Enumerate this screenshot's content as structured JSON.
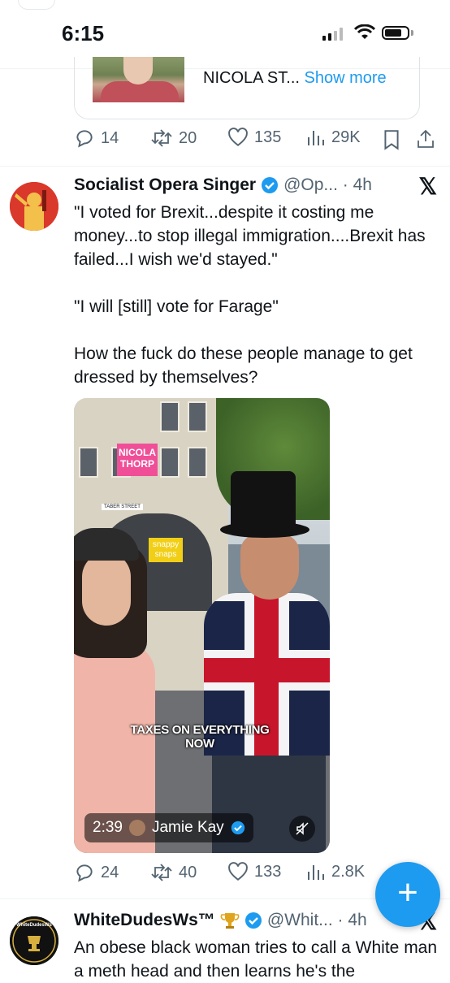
{
  "status_bar": {
    "time": "6:15"
  },
  "quoted_preview": {
    "text": "NICOLA ST...",
    "show_more": "Show more"
  },
  "tweet_prev_actions": {
    "replies": "14",
    "reposts": "20",
    "likes": "135",
    "views": "29K"
  },
  "tweet1": {
    "name": "Socialist Opera Singer",
    "handle": "@Op... · 4h",
    "text": "\"I voted for Brexit...despite it costing me money...to stop illegal immigration....Brexit has failed...I wish we'd stayed.\"\n\n\"I will [still] vote for Farage\"\n\nHow the fuck do these people manage to get dressed by themselves?",
    "media": {
      "logo_text": "NICOLA THORP",
      "street_sign": "TABER STREET",
      "shop_sign": "snappy snaps",
      "caption": "TAXES ON EVERYTHING NOW",
      "duration": "2:39",
      "author": "Jamie Kay"
    },
    "actions": {
      "replies": "24",
      "reposts": "40",
      "likes": "133",
      "views": "2.8K"
    }
  },
  "tweet2": {
    "name": "WhiteDudesWs™",
    "handle": "@Whit... · 4h",
    "text": "An obese black woman tries to call a White man a meth head and then learns he's the",
    "avatar_text": "WhiteDudesWs"
  },
  "colors": {
    "accent": "#1d9bf0",
    "text": "#0f1419",
    "muted": "#536471"
  }
}
